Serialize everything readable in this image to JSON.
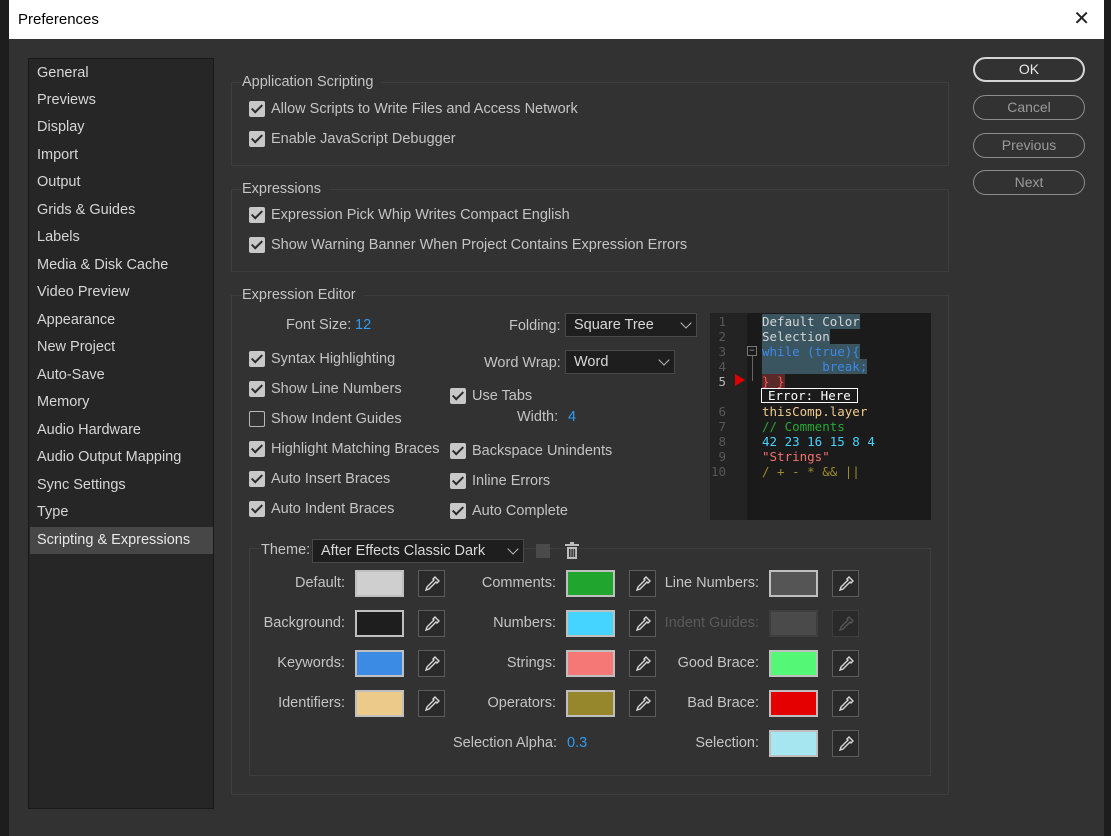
{
  "window": {
    "title": "Preferences",
    "close_glyph": "✕"
  },
  "sidebar": {
    "items": [
      "General",
      "Previews",
      "Display",
      "Import",
      "Output",
      "Grids & Guides",
      "Labels",
      "Media & Disk Cache",
      "Video Preview",
      "Appearance",
      "New Project",
      "Auto-Save",
      "Memory",
      "Audio Hardware",
      "Audio Output Mapping",
      "Sync Settings",
      "Type",
      "Scripting & Expressions"
    ],
    "selected": "Scripting & Expressions"
  },
  "buttons": {
    "ok": "OK",
    "cancel": "Cancel",
    "previous": "Previous",
    "next": "Next"
  },
  "application_scripting": {
    "title": "Application Scripting",
    "allow_scripts": {
      "label": "Allow Scripts to Write Files and Access Network",
      "checked": true
    },
    "js_debugger": {
      "label": "Enable JavaScript Debugger",
      "checked": true
    }
  },
  "expressions": {
    "title": "Expressions",
    "pick_whip": {
      "label": "Expression Pick Whip Writes Compact English",
      "checked": true
    },
    "warning_banner": {
      "label": "Show Warning Banner When Project Contains Expression Errors",
      "checked": true
    }
  },
  "editor": {
    "title": "Expression Editor",
    "font_size_label": "Font Size:",
    "font_size": "12",
    "folding_label": "Folding:",
    "folding": "Square Tree",
    "word_wrap_label": "Word Wrap:",
    "word_wrap": "Word",
    "syntax_highlighting": {
      "label": "Syntax Highlighting",
      "checked": true
    },
    "show_line_numbers": {
      "label": "Show Line Numbers",
      "checked": true
    },
    "show_indent_guides": {
      "label": "Show Indent Guides",
      "checked": false
    },
    "highlight_matching_braces": {
      "label": "Highlight Matching Braces",
      "checked": true
    },
    "auto_insert_braces": {
      "label": "Auto Insert Braces",
      "checked": true
    },
    "auto_indent_braces": {
      "label": "Auto Indent Braces",
      "checked": true
    },
    "use_tabs": {
      "label": "Use Tabs",
      "checked": true
    },
    "width_label": "Width:",
    "width": "4",
    "backspace_unindents": {
      "label": "Backspace Unindents",
      "checked": true
    },
    "inline_errors": {
      "label": "Inline Errors",
      "checked": true
    },
    "auto_complete": {
      "label": "Auto Complete",
      "checked": true
    }
  },
  "preview": {
    "line_numbers": [
      "1",
      "2",
      "3",
      "4",
      "5",
      "6",
      "7",
      "8",
      "9",
      "10"
    ],
    "lines": [
      "Default Color",
      "Selection",
      "while (true){",
      "        break;",
      "} }",
      "Error: Here",
      "thisComp.layer",
      "// Comments",
      "42 23 16 15 8 4",
      "\"Strings\"",
      "/ + - * && ||"
    ],
    "colors": {
      "default": "#d4d4d4",
      "selection_bg": "#3a5560",
      "keyword": "#3c8ae8",
      "comment": "#27a836",
      "number": "#46d3ff",
      "string": "#f2726f",
      "operator": "#9d8c2a",
      "identifier": "#f0cb8c",
      "error_marker": "#e00000"
    }
  },
  "theme": {
    "label": "Theme:",
    "value": "After Effects Classic Dark",
    "colors": [
      {
        "label": "Default:",
        "color": "#cfcfcf"
      },
      {
        "label": "Background:",
        "color": "#1e1e1e"
      },
      {
        "label": "Keywords:",
        "color": "#3b8ae4"
      },
      {
        "label": "Identifiers:",
        "color": "#ecca8a"
      },
      {
        "label": "Comments:",
        "color": "#20a52e"
      },
      {
        "label": "Numbers:",
        "color": "#44d4ff"
      },
      {
        "label": "Strings:",
        "color": "#f57876"
      },
      {
        "label": "Operators:",
        "color": "#96872c"
      },
      {
        "label": "Line Numbers:",
        "color": "#555555"
      },
      {
        "label": "Indent Guides:",
        "color": "#4a4a4a"
      },
      {
        "label": "Good Brace:",
        "color": "#55f776"
      },
      {
        "label": "Bad Brace:",
        "color": "#e50000"
      },
      {
        "label": "Selection:",
        "color": "#a6e6f1"
      }
    ],
    "selection_alpha_label": "Selection Alpha:",
    "selection_alpha": "0.3"
  }
}
